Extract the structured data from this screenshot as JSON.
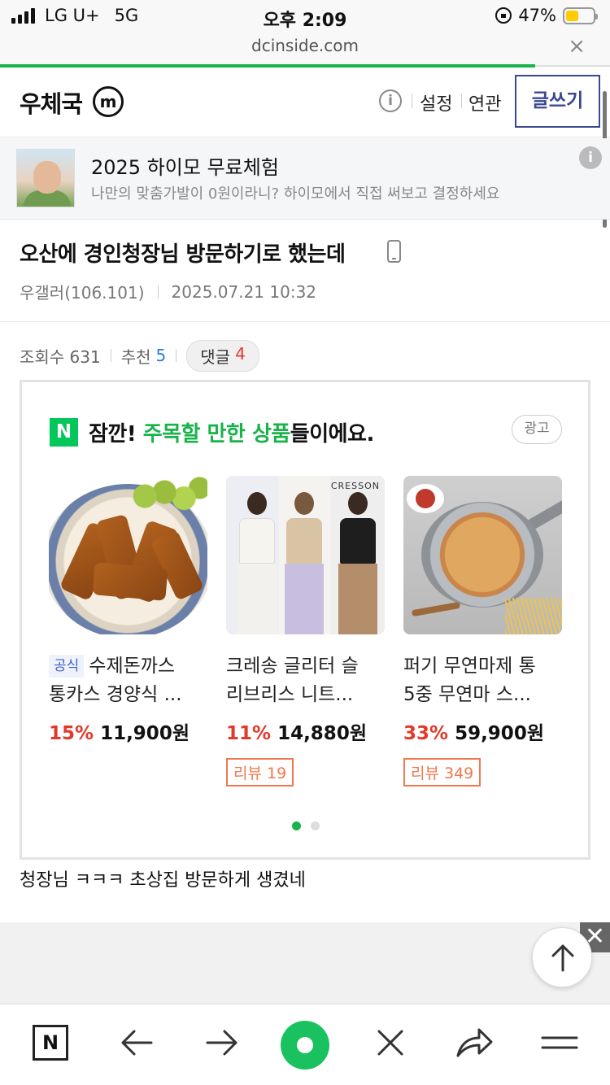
{
  "status_bar": {
    "carrier": "LG U+",
    "network": "5G",
    "time": "오후 2:09",
    "battery_percent": "47%",
    "battery_level": 0.47,
    "battery_color": "#ffcc00"
  },
  "browser": {
    "url": "dcinside.com",
    "close_icon": "×",
    "load_progress": 0.877
  },
  "gallery": {
    "name": "우체국",
    "minor_badge": "m",
    "info_icon": "i",
    "menu": [
      "설정",
      "연관"
    ],
    "write_button": "글쓰기"
  },
  "top_ad": {
    "title": "2025 하이모 무료체험",
    "subtitle": "나만의 맞춤가발이 0원이라니? 하이모에서 직접 써보고 결정하세요",
    "info_icon": "i"
  },
  "post": {
    "title": "오산에 경인청장님 방문하기로 했는데",
    "author": "우갤러(106.101)",
    "datetime": "2025.07.21 10:32",
    "views_label": "조회수 631",
    "recommend_label": "추천",
    "recommend_count": "5",
    "comments_label": "댓글",
    "comments_count": "4",
    "body": "청장님 ㅋㅋㅋ 초상집 방문하게 생겼네"
  },
  "shopping_ad": {
    "naver_logo": "N",
    "heading_prefix": "잠깐! ",
    "heading_highlight": "주목할 만한 상품",
    "heading_suffix": "들이에요.",
    "ad_badge": "광고",
    "brand_mark": "CRESSON",
    "products": [
      {
        "tag": "공식",
        "name_line1": "수제돈까스",
        "name_line2": "통카스 경양식 ...",
        "discount": "15%",
        "price": "11,900원",
        "review": ""
      },
      {
        "tag": "",
        "name_line1": "크레송 글리터 슬",
        "name_line2": "리브리스 니트...",
        "discount": "11%",
        "price": "14,880원",
        "review": "리뷰 19"
      },
      {
        "tag": "",
        "name_line1": "퍼기 무연마제 통",
        "name_line2": "5중 무연마 스...",
        "discount": "33%",
        "price": "59,900원",
        "review": "리뷰 349"
      }
    ],
    "page_count": 2,
    "active_page": 1
  },
  "overlay": {
    "close_icon": "✕"
  },
  "toolbar": {
    "naver_label": "N"
  }
}
